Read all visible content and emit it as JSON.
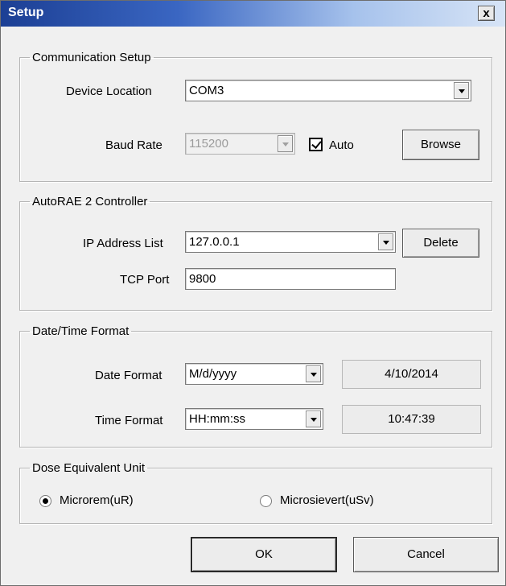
{
  "window": {
    "title": "Setup",
    "close_glyph": "x"
  },
  "communication": {
    "legend": "Communication Setup",
    "device_location_label": "Device Location",
    "device_location_value": "COM3",
    "baud_rate_label": "Baud Rate",
    "baud_rate_value": "115200",
    "auto_label": "Auto",
    "auto_checked": true,
    "browse_label": "Browse"
  },
  "controller": {
    "legend": "AutoRAE 2 Controller",
    "ip_label": "IP Address List",
    "ip_value": "127.0.0.1",
    "delete_label": "Delete",
    "tcp_label": "TCP Port",
    "tcp_value": "9800"
  },
  "datetime": {
    "legend": "Date/Time Format",
    "date_label": "Date Format",
    "date_value": "M/d/yyyy",
    "date_preview": "4/10/2014",
    "time_label": "Time Format",
    "time_value": "HH:mm:ss",
    "time_preview": "10:47:39"
  },
  "dose": {
    "legend": "Dose Equivalent Unit",
    "option_microrem": "Microrem(uR)",
    "option_microsievert": "Microsievert(uSv)",
    "selected": "Microrem(uR)"
  },
  "footer": {
    "ok_label": "OK",
    "cancel_label": "Cancel"
  }
}
